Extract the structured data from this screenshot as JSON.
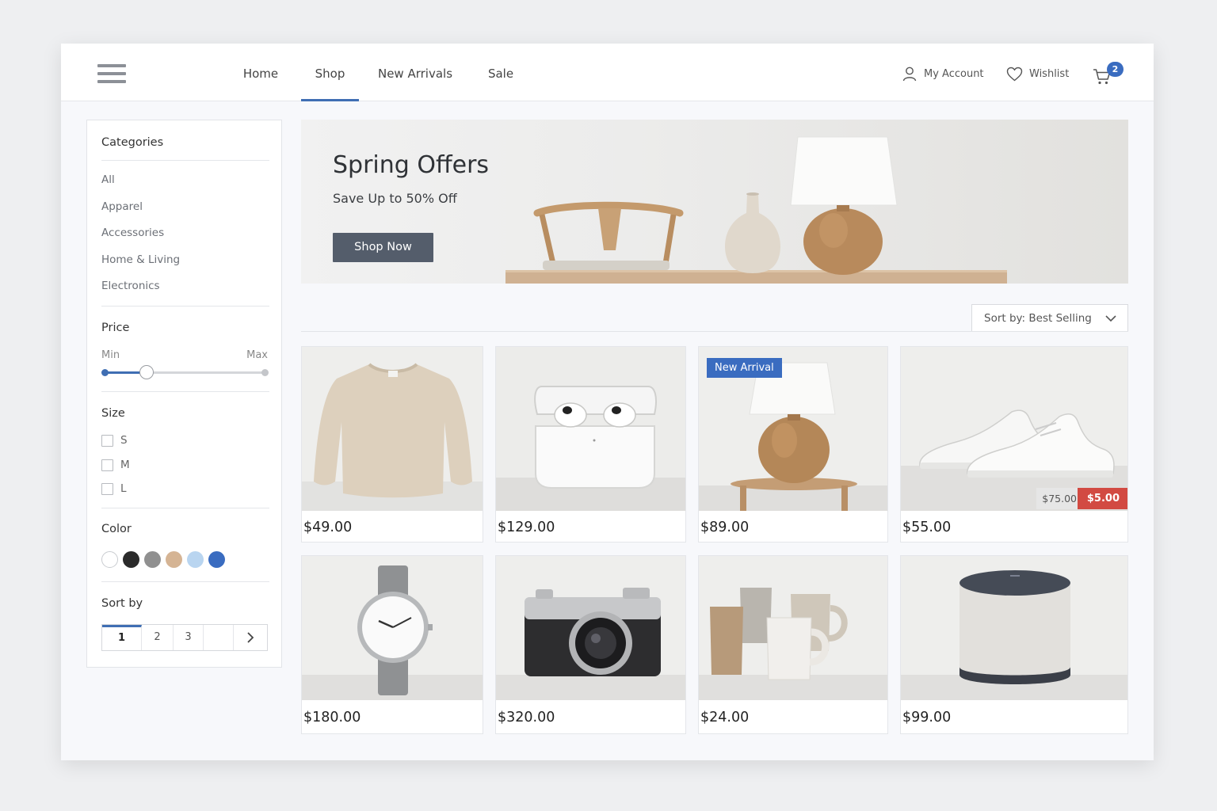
{
  "header": {
    "nav": [
      "Home",
      "Shop",
      "New Arrivals",
      "Sale"
    ],
    "active_nav": "Shop",
    "my_account": "My Account",
    "wishlist": "Wishlist",
    "cart_count": "2",
    "icons": [
      "menu-icon",
      "user-icon",
      "heart-icon",
      "cart-icon"
    ]
  },
  "sidebar": {
    "categories_title": "Categories",
    "categories": [
      "All",
      "Apparel",
      "Accessories",
      "Home & Living",
      "Electronics"
    ],
    "price_title": "Price",
    "price_min_label": "Min",
    "price_max_label": "Max",
    "price_slider_fraction": 0.26,
    "size_title": "Size",
    "sizes": [
      "S",
      "M",
      "L"
    ],
    "color_title": "Color",
    "colors": [
      "#ffffff",
      "#2b2b2b",
      "#909090",
      "#d5b494",
      "#b9d5f0",
      "#3a6cc0"
    ],
    "sort_title": "Sort by",
    "pages": [
      "1",
      "2",
      "3"
    ],
    "active_page": "1"
  },
  "hero": {
    "title": "Spring Offers",
    "subtitle": "Save Up to 50% Off",
    "button": "Shop Now"
  },
  "sort": {
    "label": "Sort by: Best Selling"
  },
  "accent_color": "#3f6eb3",
  "sale_color": "#d24a42",
  "products": [
    {
      "name": "sweater",
      "price": "$49.00"
    },
    {
      "name": "earbuds",
      "price": "$129.00"
    },
    {
      "name": "table-lamp",
      "price": "$89.00",
      "badge": "New Arrival"
    },
    {
      "name": "sneakers",
      "price": "$55.00",
      "old_price": "$75.00",
      "sale_price": "$5.00"
    },
    {
      "name": "watch",
      "price": "$180.00"
    },
    {
      "name": "camera",
      "price": "$320.00"
    },
    {
      "name": "mugs",
      "price": "$24.00"
    },
    {
      "name": "smart-speaker",
      "price": "$99.00"
    }
  ]
}
